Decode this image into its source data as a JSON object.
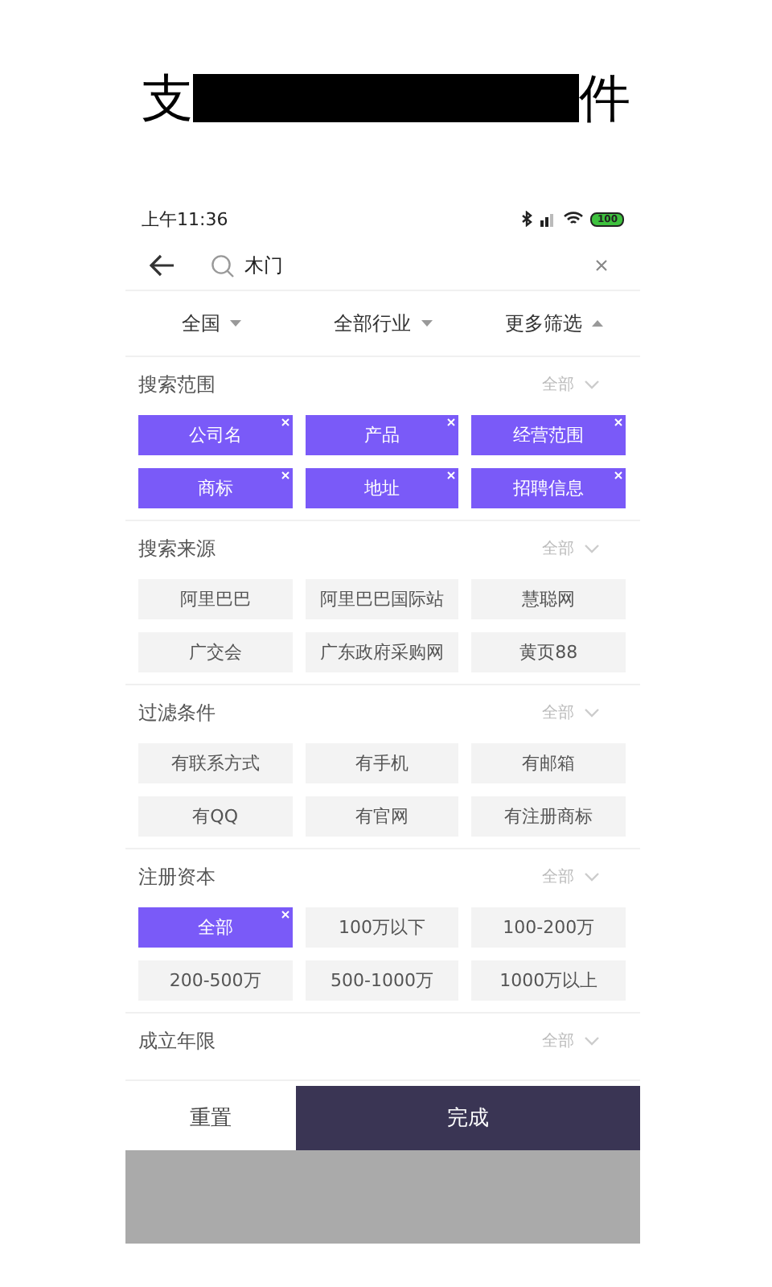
{
  "caption": {
    "parts": [
      "支",
      "件"
    ]
  },
  "status_bar": {
    "time": "上午11:36",
    "battery": "100"
  },
  "search": {
    "value": "木门"
  },
  "filter_tabs": [
    {
      "label": "全国",
      "expanded": false
    },
    {
      "label": "全部行业",
      "expanded": false
    },
    {
      "label": "更多筛选",
      "expanded": true
    }
  ],
  "sections": [
    {
      "title": "搜索范围",
      "all_label": "全部",
      "options": [
        {
          "label": "公司名",
          "selected": true
        },
        {
          "label": "产品",
          "selected": true
        },
        {
          "label": "经营范围",
          "selected": true
        },
        {
          "label": "商标",
          "selected": true
        },
        {
          "label": "地址",
          "selected": true
        },
        {
          "label": "招聘信息",
          "selected": true
        }
      ]
    },
    {
      "title": "搜索来源",
      "all_label": "全部",
      "options": [
        {
          "label": "阿里巴巴",
          "selected": false
        },
        {
          "label": "阿里巴巴国际站",
          "selected": false
        },
        {
          "label": "慧聪网",
          "selected": false
        },
        {
          "label": "广交会",
          "selected": false
        },
        {
          "label": "广东政府采购网",
          "selected": false
        },
        {
          "label": "黄页88",
          "selected": false
        }
      ]
    },
    {
      "title": "过滤条件",
      "all_label": "全部",
      "options": [
        {
          "label": "有联系方式",
          "selected": false
        },
        {
          "label": "有手机",
          "selected": false
        },
        {
          "label": "有邮箱",
          "selected": false
        },
        {
          "label": "有QQ",
          "selected": false
        },
        {
          "label": "有官网",
          "selected": false
        },
        {
          "label": "有注册商标",
          "selected": false
        }
      ]
    },
    {
      "title": "注册资本",
      "all_label": "全部",
      "options": [
        {
          "label": "全部",
          "selected": true
        },
        {
          "label": "100万以下",
          "selected": false
        },
        {
          "label": "100-200万",
          "selected": false
        },
        {
          "label": "200-500万",
          "selected": false
        },
        {
          "label": "500-1000万",
          "selected": false
        },
        {
          "label": "1000万以上",
          "selected": false
        }
      ]
    },
    {
      "title": "成立年限",
      "all_label": "全部"
    }
  ],
  "actions": {
    "reset": "重置",
    "done": "完成"
  }
}
